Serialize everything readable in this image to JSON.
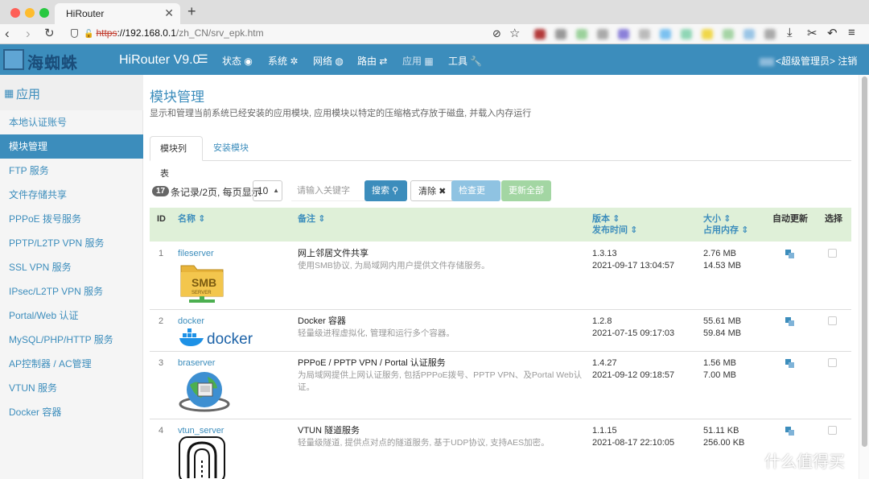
{
  "browser": {
    "tab_title": "HiRouter",
    "url_scheme": "https",
    "url_sep": "://",
    "url_host": "192.168.0.1",
    "url_path": "/zh_CN/srv_epk.htm"
  },
  "header": {
    "logo_text": "海蜘蛛",
    "brand": "HiRouter V9.0",
    "menu": [
      "状态",
      "系统",
      "网络",
      "路由",
      "应用",
      "工具"
    ],
    "user_label": "<超级管理员>",
    "logout": "注销"
  },
  "sidebar": {
    "title": "应用",
    "items": [
      "本地认证账号",
      "模块管理",
      "FTP 服务",
      "文件存储共享",
      "PPPoE 拨号服务",
      "PPTP/L2TP VPN 服务",
      "SSL VPN 服务",
      "IPsec/L2TP VPN 服务",
      "Portal/Web 认证",
      "MySQL/PHP/HTTP 服务",
      "AP控制器 / AC管理",
      "VTUN 服务",
      "Docker 容器"
    ],
    "active_index": 1
  },
  "main": {
    "title": "模块管理",
    "description": "显示和管理当前系统已经安装的应用模块, 应用模块以特定的压缩格式存放于磁盘, 并载入内存运行",
    "tabs": [
      "模块列表",
      "安装模块"
    ],
    "toolbar": {
      "count": "17",
      "records_text": "条记录/2页, 每页显示",
      "page_size": "10",
      "search_placeholder": "请输入关键字",
      "search_btn": "搜索",
      "clear_btn": "清除",
      "check_btn": "检查更新",
      "update_all_btn": "更新全部"
    },
    "columns": {
      "id": "ID",
      "name": "名称",
      "note": "备注",
      "version": "版本",
      "published": "发布时间",
      "size": "大小",
      "memory": "占用内存",
      "auto_update": "自动更新",
      "select": "选择"
    },
    "rows": [
      {
        "id": "1",
        "name": "fileserver",
        "logo": "smb-server-logo",
        "logo_text": "SMB",
        "logo_sub": "SERVER",
        "note": "网上邻居文件共享",
        "sub": "使用SMB协议, 为局域网内用户提供文件存储服务。",
        "version": "1.3.13",
        "published": "2021-09-17 13:04:57",
        "size": "2.76 MB",
        "memory": "14.53 MB"
      },
      {
        "id": "2",
        "name": "docker",
        "logo": "docker-logo",
        "logo_text": "docker",
        "note": "Docker 容器",
        "sub": "轻量级进程虚拟化, 管理和运行多个容器。",
        "version": "1.2.8",
        "published": "2021-07-15 09:17:03",
        "size": "55.61 MB",
        "memory": "59.84 MB"
      },
      {
        "id": "3",
        "name": "braserver",
        "logo": "globe-server-logo",
        "note": "PPPoE / PPTP VPN / Portal 认证服务",
        "sub": "为局域网提供上网认证服务, 包括PPPoE拨号、PPTP VPN、及Portal Web认证。",
        "version": "1.4.27",
        "published": "2021-09-12 09:18:57",
        "size": "1.56 MB",
        "memory": "7.00 MB"
      },
      {
        "id": "4",
        "name": "vtun_server",
        "logo": "tunnel-logo",
        "note": "VTUN 隧道服务",
        "sub": "轻量级隧道, 提供点对点的隧道服务, 基于UDP协议, 支持AES加密。",
        "version": "1.1.15",
        "published": "2021-08-17 22:10:05",
        "size": "51.11 KB",
        "memory": "256.00 KB"
      }
    ]
  },
  "watermark": {
    "icon": "值",
    "text": "什么值得买"
  },
  "colors": {
    "primary": "#3c8dbc",
    "header_row": "#dff0d8",
    "sidebar_bg": "#f5f5f5"
  }
}
